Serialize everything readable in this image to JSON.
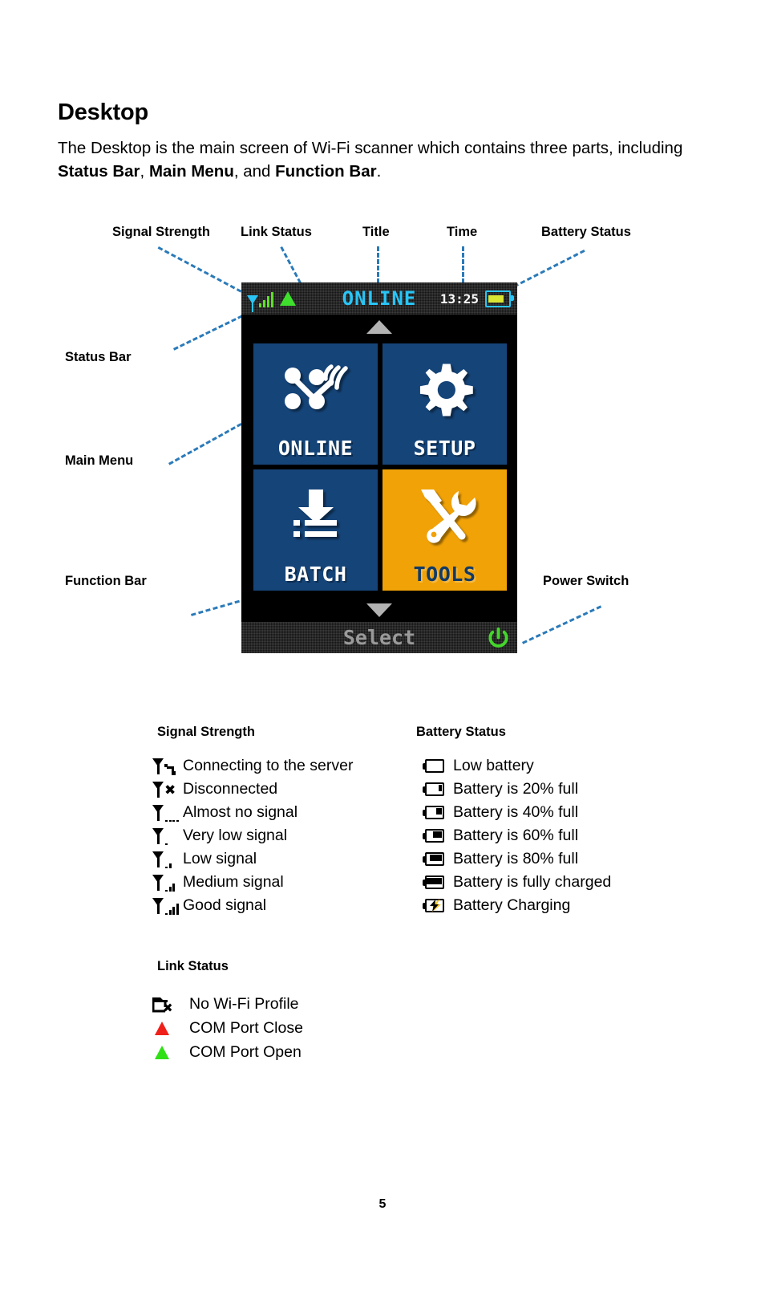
{
  "document": {
    "heading": "Desktop",
    "intro_part1": "The Desktop is the main screen of Wi-Fi scanner which contains three parts, including ",
    "intro_b1": "Status Bar",
    "intro_sep1": ", ",
    "intro_b2": "Main Menu",
    "intro_sep2": ", and ",
    "intro_b3": "Function Bar",
    "intro_end": ".",
    "page_number": "5"
  },
  "callouts": {
    "signal_strength": "Signal Strength",
    "link_status": "Link Status",
    "title": "Title",
    "time": "Time",
    "battery_status": "Battery Status",
    "status_bar": "Status Bar",
    "main_menu": "Main Menu",
    "function_bar": "Function Bar",
    "power_switch": "Power Switch"
  },
  "device": {
    "status_bar": {
      "title": "ONLINE",
      "time": "13:25",
      "signal_icon": "signal-strength-icon",
      "link_icon": "triangle-up-green-icon",
      "battery_icon": "battery-full-icon"
    },
    "menu": {
      "scroll_up_icon": "arrow-up-icon",
      "scroll_down_icon": "arrow-down-icon",
      "tiles": [
        {
          "label": "ONLINE",
          "icon": "network-wifi-icon",
          "selected": false
        },
        {
          "label": "SETUP",
          "icon": "gear-icon",
          "selected": false
        },
        {
          "label": "BATCH",
          "icon": "download-list-icon",
          "selected": false
        },
        {
          "label": "TOOLS",
          "icon": "hammer-wrench-icon",
          "selected": true
        }
      ]
    },
    "function_bar": {
      "label": "Select",
      "power_icon": "power-icon"
    },
    "colors": {
      "tile": "#154478",
      "tile_selected": "#f1a207",
      "title_cyan": "#29c5f6",
      "signal_green": "#5ede2a",
      "power_green": "#44d62c",
      "bar_background": "#141414",
      "screen_background": "#000000",
      "leader_line": "#2a7ab9"
    }
  },
  "legend": {
    "signal_strength": {
      "title": "Signal Strength",
      "items": [
        {
          "icon": "signal-connecting-icon",
          "label": "Connecting to the server"
        },
        {
          "icon": "signal-disconnected-icon",
          "label": "Disconnected"
        },
        {
          "icon": "signal-none-icon",
          "label": "Almost no signal"
        },
        {
          "icon": "signal-very-low-icon",
          "label": "Very low signal"
        },
        {
          "icon": "signal-low-icon",
          "label": "Low signal"
        },
        {
          "icon": "signal-medium-icon",
          "label": "Medium signal"
        },
        {
          "icon": "signal-good-icon",
          "label": "Good signal"
        }
      ]
    },
    "link_status": {
      "title": "Link Status",
      "items": [
        {
          "icon": "folder-x-icon",
          "label": "No Wi-Fi Profile"
        },
        {
          "icon": "triangle-up-red-icon",
          "label": "COM Port Close"
        },
        {
          "icon": "triangle-up-green-icon",
          "label": "COM Port Open"
        }
      ]
    },
    "battery_status": {
      "title": "Battery Status",
      "items": [
        {
          "icon": "battery-empty-icon",
          "label": "Low battery",
          "fill": 0
        },
        {
          "icon": "battery-20-icon",
          "label": "Battery is 20% full",
          "fill": 20
        },
        {
          "icon": "battery-40-icon",
          "label": "Battery is 40% full",
          "fill": 40
        },
        {
          "icon": "battery-60-icon",
          "label": "Battery is 60% full",
          "fill": 60
        },
        {
          "icon": "battery-80-icon",
          "label": "Battery is 80% full",
          "fill": 80
        },
        {
          "icon": "battery-full-icon",
          "label": "Battery is fully charged",
          "fill": 100
        },
        {
          "icon": "battery-charging-icon",
          "label": "Battery Charging",
          "fill": -1
        }
      ]
    }
  }
}
